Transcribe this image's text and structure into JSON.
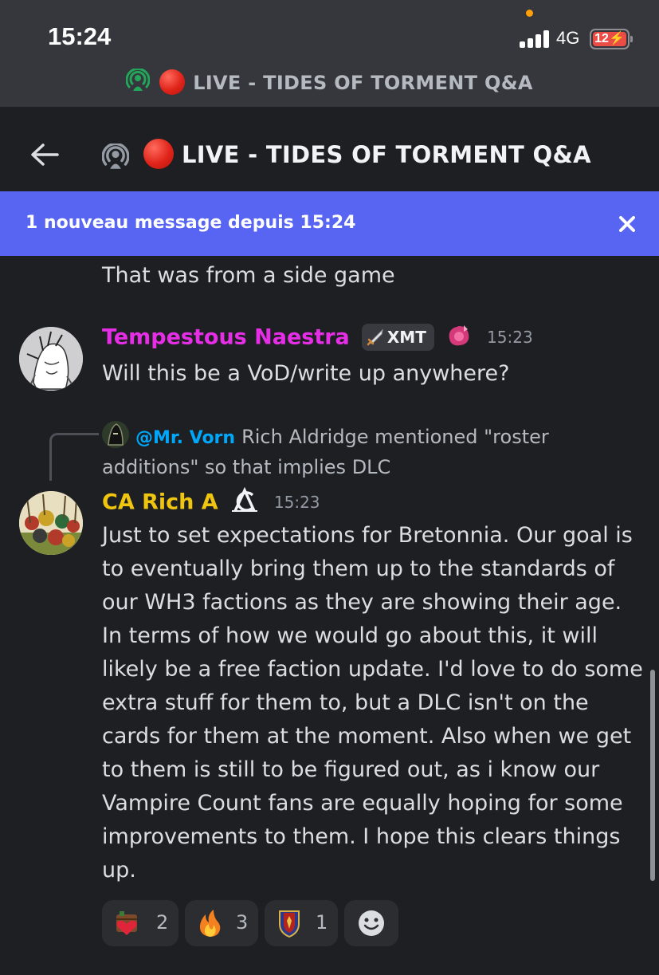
{
  "status_bar": {
    "time": "15:24",
    "network": "4G",
    "battery": "12⚡"
  },
  "live_banner": {
    "text": "LIVE - TIDES OF TORMENT Q&A"
  },
  "header": {
    "title": "LIVE - TIDES OF TORMENT Q&A",
    "icons": [
      "back-arrow-icon",
      "stage-channel-icon",
      "red-circle-icon"
    ]
  },
  "new_messages_banner": {
    "text": "1 nouveau message depuis 15:24"
  },
  "messages": [
    {
      "text": "That was from a side game"
    },
    {
      "author": "Tempestous Naestra",
      "author_color": "#e72ee7",
      "tag": "XMT",
      "timestamp": "15:23",
      "text": "Will this be a VoD/write up anywhere?"
    },
    {
      "reply": {
        "mention": "@Mr. Vorn",
        "text": "Rich Aldridge mentioned \"roster additions\" so that implies DLC"
      },
      "author": "CA Rich A",
      "author_color": "#f0c50f",
      "timestamp": "15:23",
      "lines": [
        "Just to set expectations for Bretonnia. Our goal is",
        "to eventually bring them up to the standards of",
        "our WH3 factions as they are showing their age.",
        "In terms of how we would go about this, it will",
        "likely be a free faction update. I'd love to do some",
        "extra stuff for them to, but a DLC isn't on the",
        "cards for them at the moment. Also when we get",
        "to them is still to be figured out, as i know our",
        "Vampire Count fans are equally hoping for some",
        "improvements to them. I hope this clears things",
        "up."
      ],
      "reactions": [
        {
          "emoji": "heart-chest-emoji",
          "count": "2"
        },
        {
          "emoji": "fire-emoji",
          "count": "3"
        },
        {
          "emoji": "bretonnia-shield-emoji",
          "count": "1"
        },
        {
          "emoji": "add-reaction-icon",
          "count": ""
        }
      ]
    }
  ],
  "colors": {
    "background": "#1e1f22",
    "status_bar": "#36373c",
    "banner": "#5865f2",
    "mention": "#00a8fc"
  }
}
